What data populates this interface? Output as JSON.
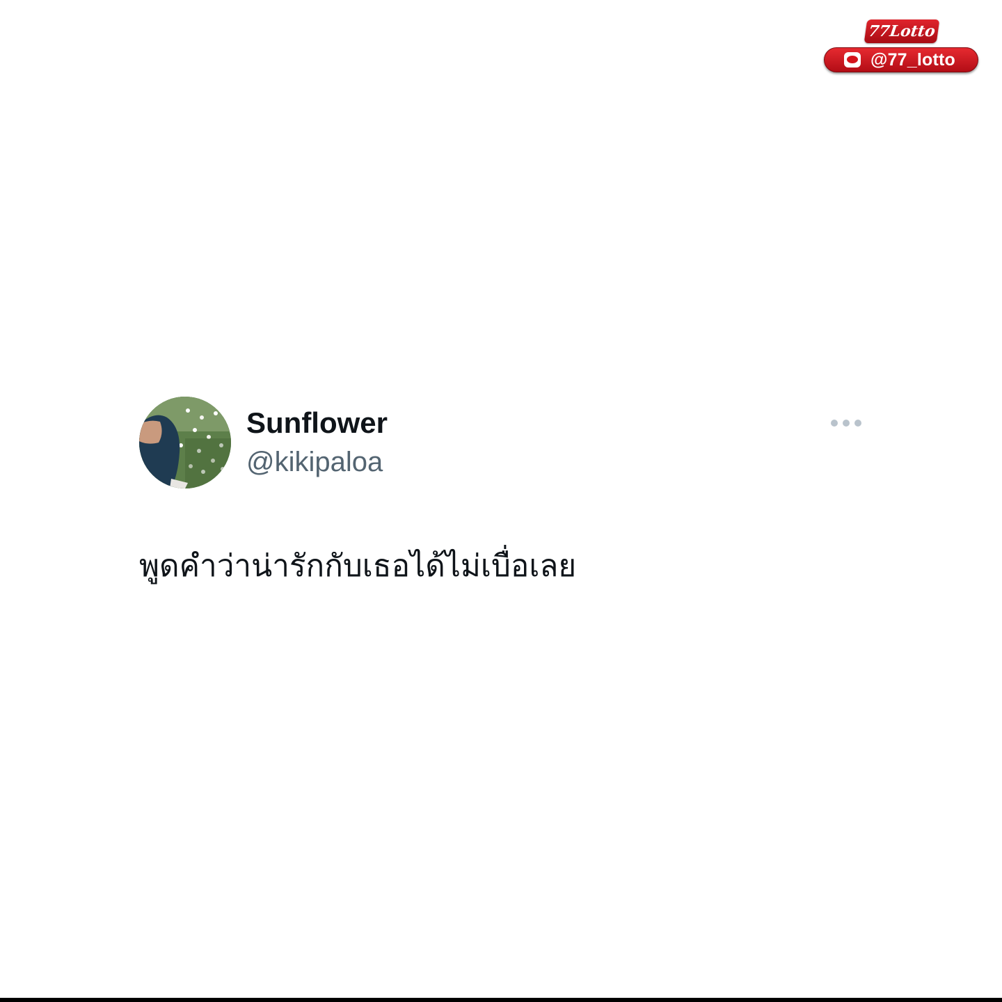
{
  "watermark": {
    "brand": "77Lotto",
    "line_icon": "line-app-icon",
    "handle": "@77_lotto",
    "colors": {
      "badge_red": "#d5141c",
      "text": "#ffffff"
    }
  },
  "tweet": {
    "display_name": "Sunflower",
    "handle": "@kikipaloa",
    "more_icon": "more-options-icon",
    "text": "พูดคำว่าน่ารักกับเธอได้ไม่เบื่อเลย",
    "colors": {
      "name": "#0f1419",
      "handle": "#536471",
      "dots": "#b9c3cc"
    }
  }
}
